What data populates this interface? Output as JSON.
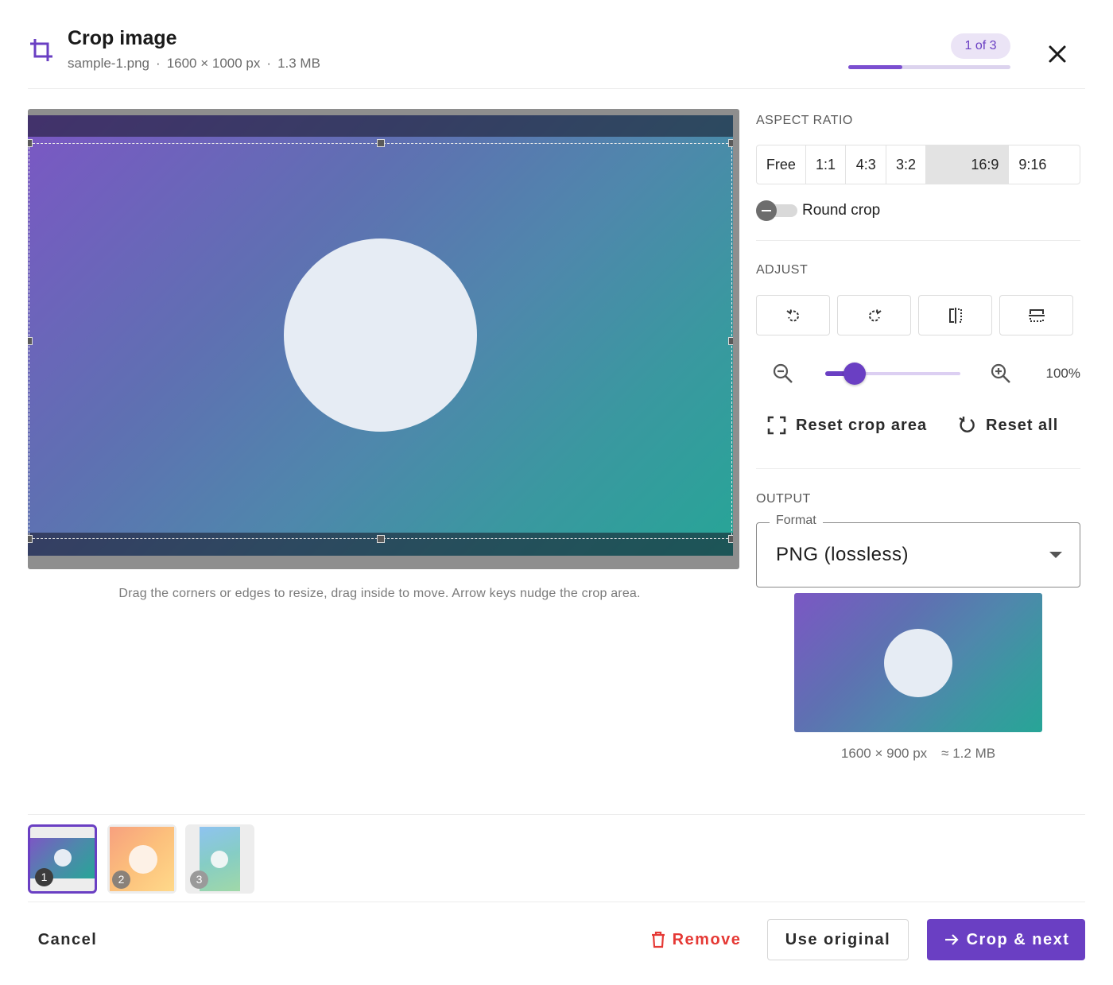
{
  "header": {
    "title": "Crop image",
    "filename": "sample-1.png",
    "dimensions": "1600 × 1000 px",
    "filesize": "1.3 MB",
    "separator": "·",
    "counter": "1 of 3",
    "progress_fraction": 0.333
  },
  "canvas": {
    "hint": "Drag the corners or edges to resize, drag inside to move. Arrow keys nudge the crop area."
  },
  "aspect_ratio": {
    "label": "ASPECT RATIO",
    "options": [
      "Free",
      "1:1",
      "4:3",
      "3:2",
      "16:9",
      "9:16"
    ],
    "selected": "16:9"
  },
  "round_crop": {
    "label": "Round crop",
    "enabled": false
  },
  "adjust": {
    "label": "ADJUST",
    "tools": [
      "rotate-left-icon",
      "rotate-right-icon",
      "flip-horizontal-icon",
      "flip-vertical-icon"
    ],
    "zoom_percent": 100,
    "zoom_value_label": "100%",
    "zoom_slider_fraction": 0.22,
    "reset_crop_label": "Reset crop area",
    "reset_all_label": "Reset all"
  },
  "output": {
    "label": "OUTPUT",
    "format_legend": "Format",
    "format_value": "PNG (lossless)",
    "preview_dimensions": "1600 × 900 px",
    "preview_size": "≈ 1.2 MB"
  },
  "thumbnails": [
    {
      "index": "1",
      "active": true
    },
    {
      "index": "2",
      "active": false
    },
    {
      "index": "3",
      "active": false
    }
  ],
  "footer": {
    "cancel_label": "Cancel",
    "remove_label": "Remove",
    "original_label": "Use original",
    "next_label": "Crop & next"
  },
  "colors": {
    "accent": "#6a3fc3",
    "danger": "#e53935",
    "pill_bg": "#ebe4f6"
  }
}
